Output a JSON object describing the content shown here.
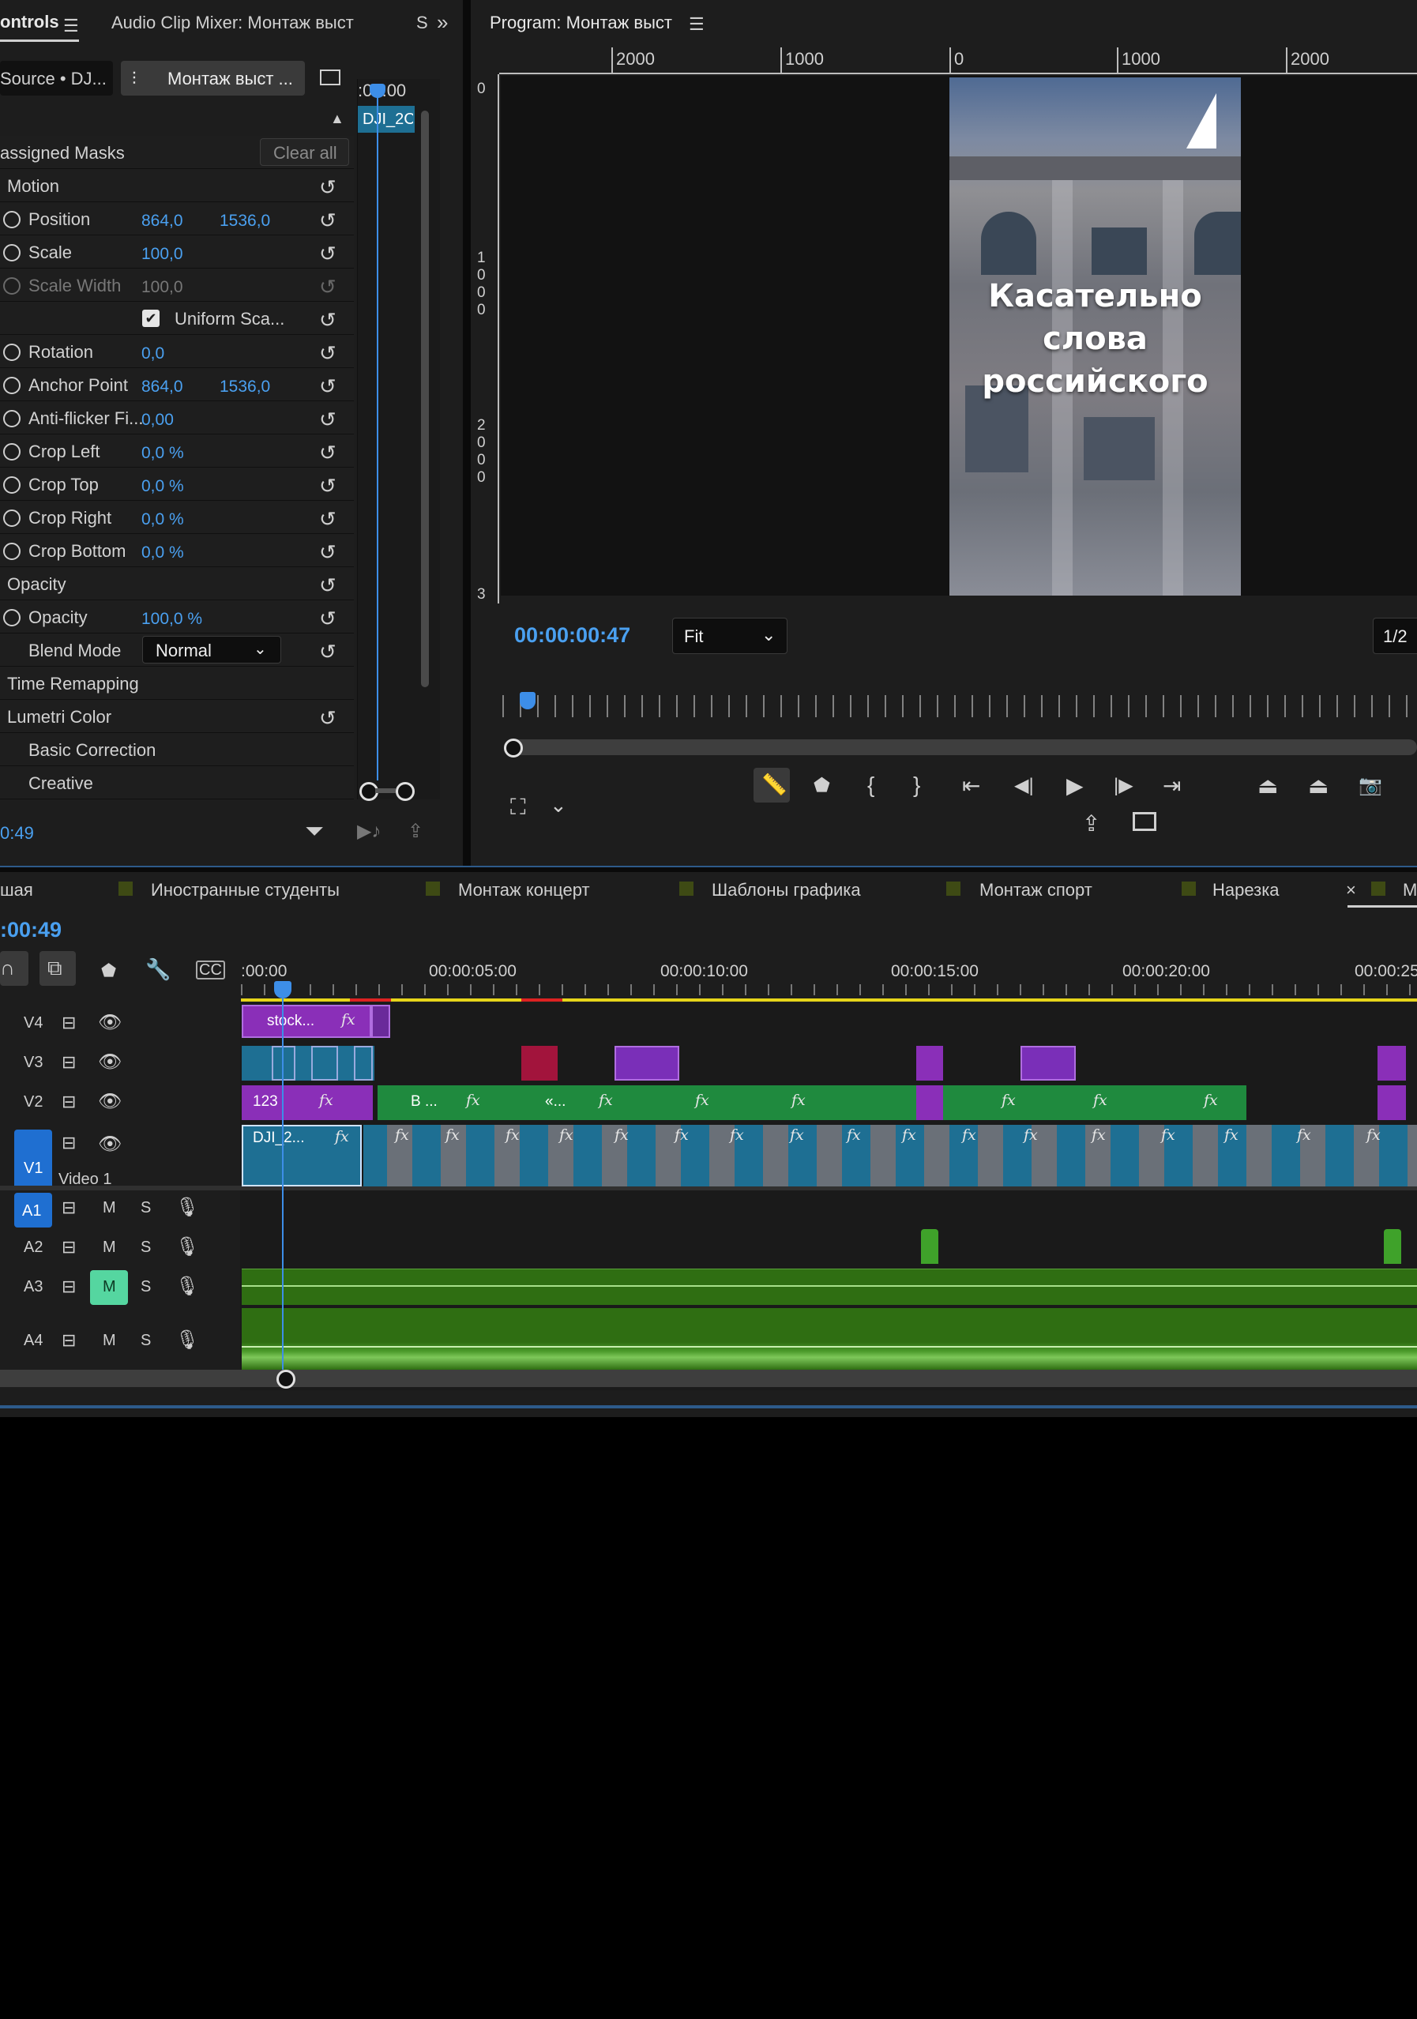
{
  "effect_controls": {
    "tab_title": "ontrols",
    "tab_audio_mixer": "Audio Clip Mixer: Монтаж выст",
    "tab_more": "S",
    "source_label": "Source • DJ...",
    "sequence_label": "Монтаж выст ...",
    "mini_timecode": ":00:00",
    "mini_clip_label": "DJI_2C",
    "assigned_masks": "assigned Masks",
    "clear_all": "Clear all",
    "motion": "Motion",
    "position": "Position",
    "position_x": "864,0",
    "position_y": "1536,0",
    "scale": "Scale",
    "scale_value": "100,0",
    "scale_width": "Scale Width",
    "scale_width_value": "100,0",
    "uniform_scale": "Uniform Sca...",
    "rotation": "Rotation",
    "rotation_value": "0,0",
    "anchor_point": "Anchor Point",
    "anchor_x": "864,0",
    "anchor_y": "1536,0",
    "anti_flicker": "Anti-flicker Fi...",
    "anti_flicker_value": "0,00",
    "crop_left": "Crop Left",
    "crop_left_value": "0,0 %",
    "crop_top": "Crop Top",
    "crop_top_value": "0,0 %",
    "crop_right": "Crop Right",
    "crop_right_value": "0,0 %",
    "crop_bottom": "Crop Bottom",
    "crop_bottom_value": "0,0 %",
    "opacity_section": "Opacity",
    "opacity": "Opacity",
    "opacity_value": "100,0 %",
    "blend_mode": "Blend Mode",
    "blend_mode_value": "Normal",
    "time_remapping": "Time Remapping",
    "lumetri_color": "Lumetri Color",
    "basic_correction": "Basic Correction",
    "creative": "Creative",
    "bottom_timecode": "0:49"
  },
  "program": {
    "title": "Program: Монтаж выст",
    "ruler_h": [
      "2000",
      "1000",
      "0",
      "1000",
      "2000"
    ],
    "ruler_v": [
      "0",
      "1\n0\n0\n0",
      "2\n0\n0\n0",
      "3"
    ],
    "overlay_text": [
      "Касательно",
      "слова",
      "российского"
    ],
    "timecode": "00:00:00:47",
    "zoom": "Fit",
    "resolution": "1/2"
  },
  "timeline": {
    "tabs": [
      {
        "label": "шая"
      },
      {
        "label": "Иностранные студенты"
      },
      {
        "label": "Монтаж концерт"
      },
      {
        "label": "Шаблоны графика"
      },
      {
        "label": "Монтаж спорт"
      },
      {
        "label": "Нарезка"
      },
      {
        "label": "M"
      }
    ],
    "close_symbol": "×",
    "timecode": ":00:49",
    "ruler": [
      ":00:00",
      "00:00:05:00",
      "00:00:10:00",
      "00:00:15:00",
      "00:00:20:00",
      "00:00:25"
    ],
    "tracks": {
      "v4": "V4",
      "v3": "V3",
      "v2": "V2",
      "v1": "V1",
      "v1_name": "Video 1",
      "a1": "A1",
      "a2": "A2",
      "a3": "A3",
      "a4": "A4",
      "m": "M",
      "s": "S"
    },
    "clips": {
      "v4_stock": "stock...",
      "v2_123": "123",
      "v2_b": "B ...",
      "v2_arrow": "«...",
      "v1_dji": "DJI_2...",
      "fx": "fx"
    }
  },
  "colors": {
    "accent_blue": "#4aa0f0",
    "v1_blue": "#1f6fd1",
    "clip_green": "#1f8a3e",
    "clip_purple": "#8a2fb8",
    "clip_teal": "#1e6f93",
    "audio_green": "#2f6e12",
    "mute_green": "#55d6a0"
  }
}
